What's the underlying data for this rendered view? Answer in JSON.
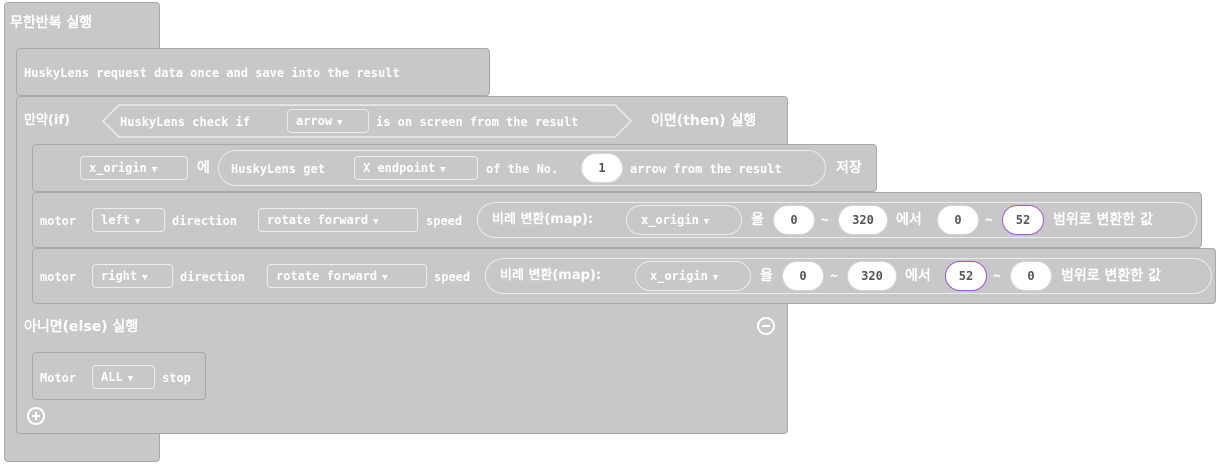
{
  "forever": {
    "label": "무한반복 실행"
  },
  "request": {
    "label": "HuskyLens request data once and save into the result"
  },
  "if_block": {
    "if_label": "만약(if)",
    "check_prefix": "HuskyLens check if",
    "check_dropdown": "arrow",
    "check_suffix": "is on screen from the result",
    "then_label": "이면(then) 실행",
    "else_label": "아니면(else) 실행"
  },
  "assign": {
    "var_dropdown": "x_origin",
    "josa": "에",
    "get_prefix": "HuskyLens get",
    "get_dropdown": "X endpoint",
    "of_label": "of the No.",
    "number": "1",
    "suffix": "arrow from the result",
    "store": "저장"
  },
  "motor_left": {
    "motor": "motor",
    "side": "left",
    "direction": "direction",
    "rotate": "rotate forward",
    "speed": "speed",
    "map_label": "비례 변환(map):",
    "var": "x_origin",
    "eul": "을",
    "from_low": "0",
    "tilde": "~",
    "from_high": "320",
    "eseo": "에서",
    "to_low": "0",
    "to_high": "52",
    "range_label": "범위로 변환한 값"
  },
  "motor_right": {
    "motor": "motor",
    "side": "right",
    "direction": "direction",
    "rotate": "rotate forward",
    "speed": "speed",
    "map_label": "비례 변환(map):",
    "var": "x_origin",
    "eul": "을",
    "from_low": "0",
    "tilde": "~",
    "from_high": "320",
    "eseo": "에서",
    "to_low": "52",
    "to_high": "0",
    "range_label": "범위로 변환한 값"
  },
  "motor_stop": {
    "motor": "Motor",
    "target": "ALL",
    "stop": "stop"
  },
  "icons": {
    "minus": "minus-circle-icon",
    "plus": "plus-circle-icon",
    "dropdown": "triangle-down-icon"
  },
  "colors": {
    "block": "#c8c8c8",
    "block_border": "#a9a9a9",
    "text": "#ffffff",
    "number_text": "#555555",
    "selected_outline": "#9b59d0"
  }
}
